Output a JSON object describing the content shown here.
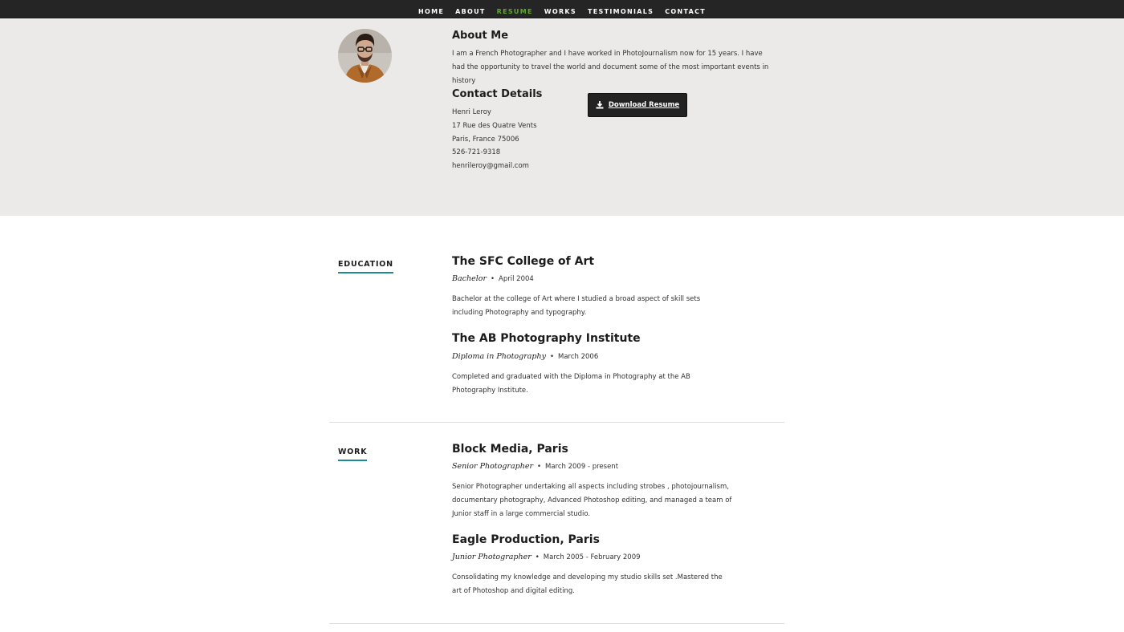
{
  "nav": {
    "items": [
      {
        "label": "HOME",
        "active": false
      },
      {
        "label": "ABOUT",
        "active": false
      },
      {
        "label": "RESUME",
        "active": true
      },
      {
        "label": "WORKS",
        "active": false
      },
      {
        "label": "TESTIMONIALS",
        "active": false
      },
      {
        "label": "CONTACT",
        "active": false
      }
    ]
  },
  "about": {
    "title": "About Me",
    "text": "I am a French Photographer and I have worked in PhotoJournalism now for 15 years. I have had the opportunity to travel the world and document some of the most important events in history",
    "contact_title": "Contact Details",
    "contact": {
      "name": "Henri Leroy",
      "address1": "17 Rue des Quatre Vents",
      "address2": "Paris, France 75006",
      "phone": "526-721-9318",
      "email": "henrileroy@gmail.com"
    },
    "download_label": "Download Resume"
  },
  "education": {
    "label": "EDUCATION",
    "entries": [
      {
        "title": "The SFC College of Art",
        "role": "Bachelor",
        "date": "April 2004",
        "desc": "Bachelor at the college of Art where I studied a broad aspect of skill sets including Photography and typography."
      },
      {
        "title": "The AB Photography Institute",
        "role": "Diploma in Photography",
        "date": "March 2006",
        "desc": "Completed and graduated with the Diploma in Photography at the AB Photography Institute."
      }
    ]
  },
  "work": {
    "label": "WORK",
    "entries": [
      {
        "title": "Block Media, Paris",
        "role": "Senior Photographer",
        "date": "March 2009 - present",
        "desc": "Senior Photographer undertaking all aspects including strobes , photojournalism, documentary photography, Advanced Photoshop editing, and managed a team of Junior staff in a large commercial studio."
      },
      {
        "title": "Eagle Production, Paris",
        "role": "Junior Photographer",
        "date": "March 2005 - February 2009",
        "desc": "Consolidating my knowledge and developing my studio skills set .Mastered the art of Photoshop and digital editing."
      }
    ]
  },
  "colors": {
    "nav_bg": "#252525",
    "active": "#5fa832",
    "about_bg": "#ebeae8",
    "accent": "#1a8b97",
    "button_bg": "#222222"
  }
}
